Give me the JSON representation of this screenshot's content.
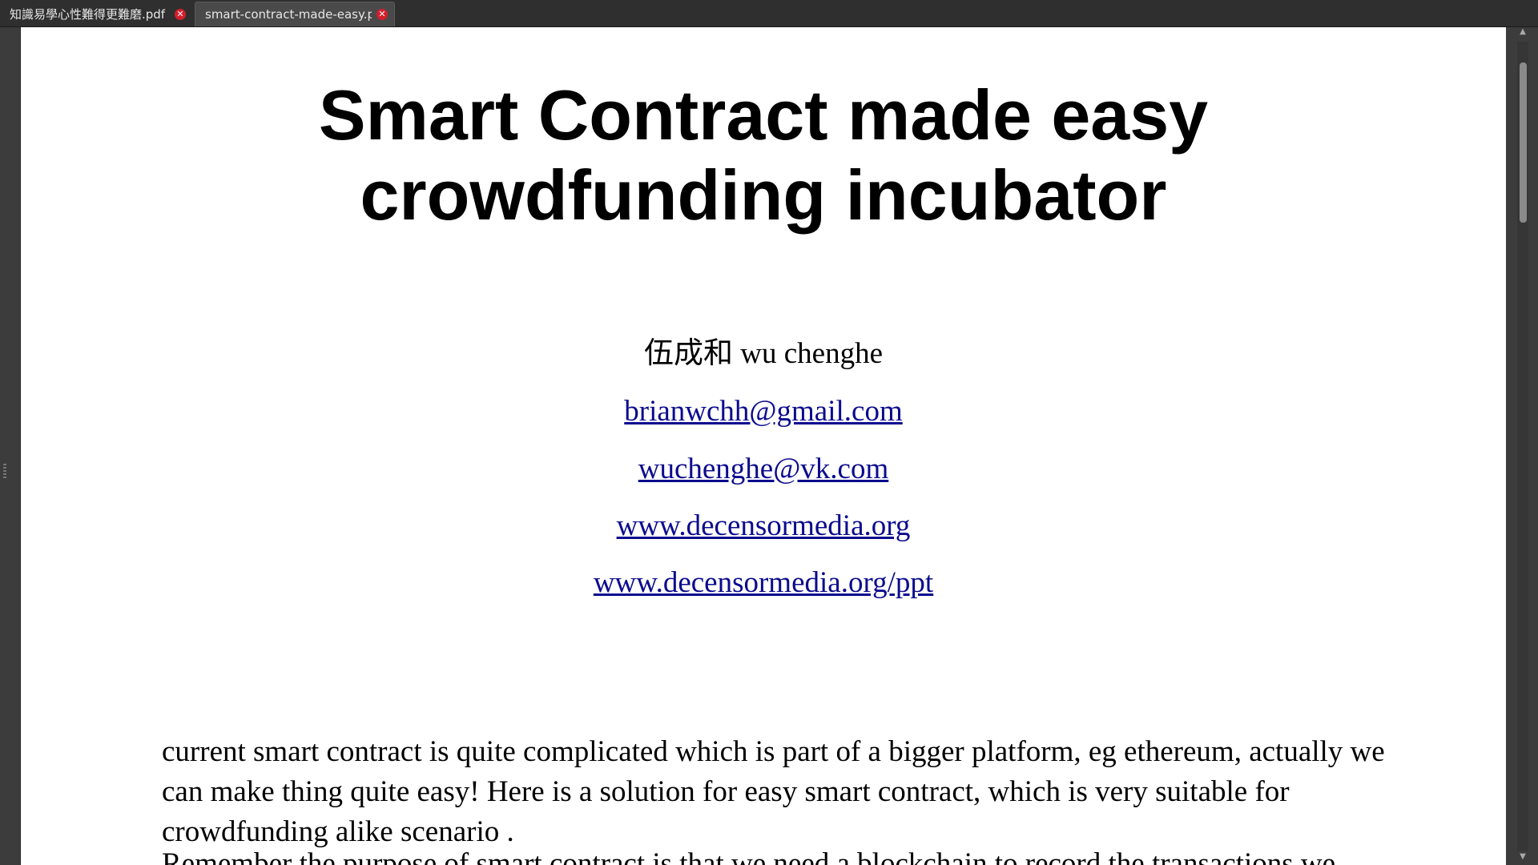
{
  "tabs": [
    {
      "label": "知識易學心性難得更難磨.pdf",
      "close_icon": "✕"
    },
    {
      "label": "smart-contract-made-easy.pdf",
      "close_icon": "✕"
    }
  ],
  "document": {
    "title_line1": "Smart Contract made easy",
    "title_line2": "crowdfunding incubator",
    "author": "伍成和 wu chenghe",
    "links": [
      "brianwchh@gmail.com",
      "wuchenghe@vk.com",
      "www.decensormedia.org",
      "www.decensormedia.org/ppt"
    ],
    "paragraph1": "current smart contract is quite complicated which is part of a bigger platform, eg ethereum, actually we can make thing quite easy! Here is a solution for easy smart contract, which is very suitable for crowdfunding alike scenario .",
    "paragraph2": "Remember the purpose of smart contract is that we need a blockchain to record the transactions we"
  },
  "scrollbar": {
    "up_arrow": "▲",
    "down_arrow": "▼"
  },
  "colors": {
    "link": "#0b0b8e",
    "tab_close": "#d21f2b",
    "chrome": "#3b3b3b"
  }
}
